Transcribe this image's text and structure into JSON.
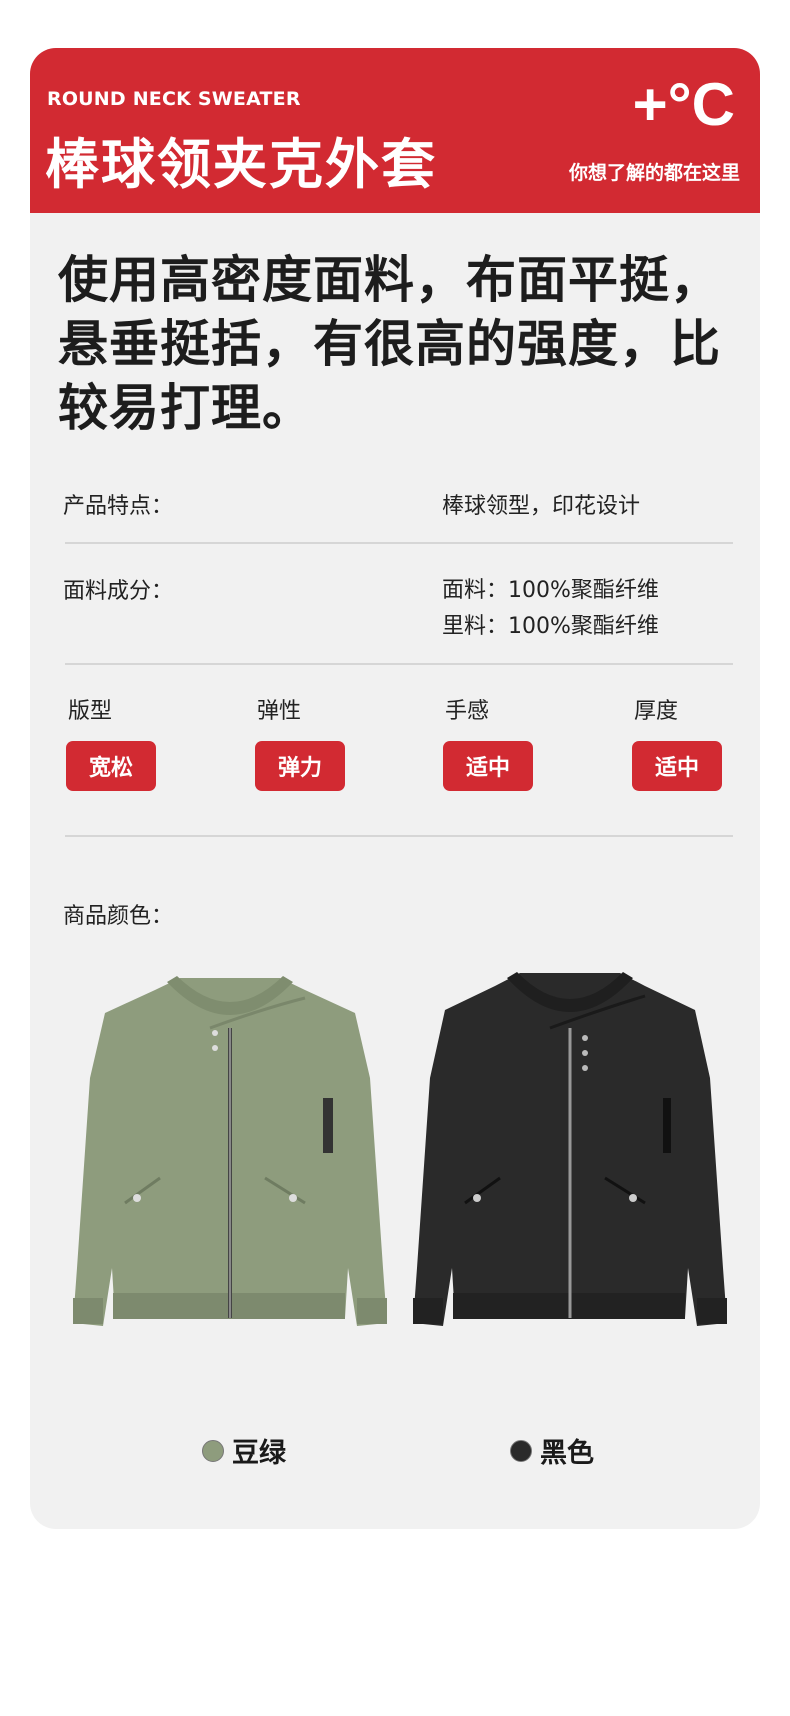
{
  "banner": {
    "en_title": "ROUND NECK SWEATER",
    "title": "棒球领夹克外套",
    "temp_mark": "+°C",
    "subtitle": "你想了解的都在这里"
  },
  "headline": "使用高密度面料，布面平挺，悬垂挺括，有很高的强度，比较易打理。",
  "specs": {
    "feature_label": "产品特点：",
    "feature_value": "棒球领型，印花设计",
    "fabric_label": "面料成分：",
    "fabric_value_1": "面料：100%聚酯纤维",
    "fabric_value_2": "里料：100%聚酯纤维"
  },
  "attributes": [
    {
      "label": "版型",
      "value": "宽松"
    },
    {
      "label": "弹性",
      "value": "弹力"
    },
    {
      "label": "手感",
      "value": "适中"
    },
    {
      "label": "厚度",
      "value": "适中"
    }
  ],
  "colors_label": "商品颜色：",
  "colors": [
    {
      "name": "豆绿",
      "hex": "#8e9c7d"
    },
    {
      "name": "黑色",
      "hex": "#2a2a2a"
    }
  ],
  "accent": "#d22a32"
}
